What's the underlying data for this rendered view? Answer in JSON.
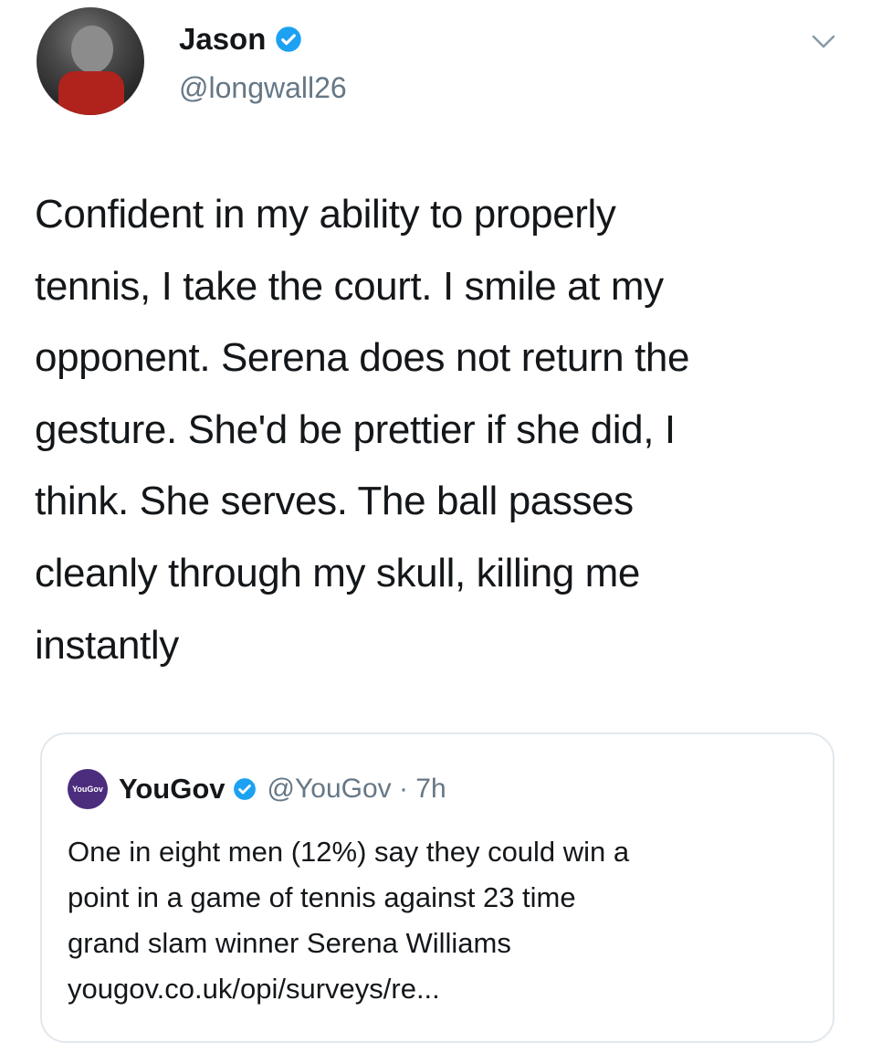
{
  "tweet": {
    "author": {
      "name": "Jason",
      "handle": "@longwall26"
    },
    "text": "Confident in my ability to properly\ntennis, I take the court. I smile at my\nopponent. Serena does not return the\ngesture. She'd be prettier if she did, I\nthink. She serves. The ball passes\ncleanly through my skull, killing me\ninstantly",
    "icons": {
      "verified": "verified-badge-icon",
      "menu": "chevron-down-icon"
    }
  },
  "quoted_tweet": {
    "name": "YouGov",
    "meta": "@YouGov · 7h",
    "logo_text": "YouGov",
    "text": "One in eight men (12%) say they could win a\npoint in a game of tennis against 23 time\ngrand slam winner Serena Williams\nyougov.co.uk/opi/surveys/re..."
  },
  "colors": {
    "verified": "#1da1f2",
    "secondary_text": "#657786",
    "border": "#e1e8ed",
    "yougov_logo": "#4b2c7d"
  }
}
